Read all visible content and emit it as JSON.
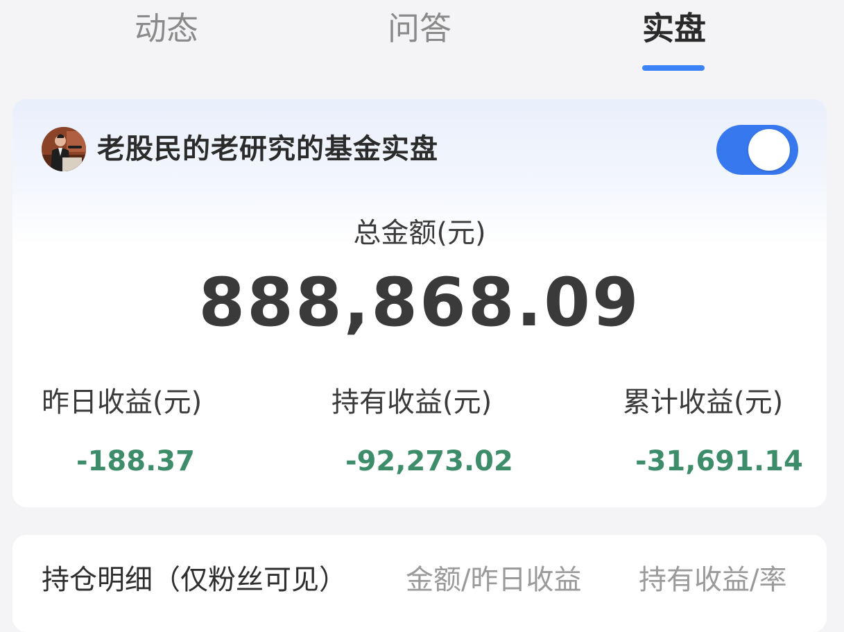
{
  "tabs": [
    {
      "label": "动态",
      "active": false
    },
    {
      "label": "问答",
      "active": false
    },
    {
      "label": "实盘",
      "active": true
    }
  ],
  "accent_color": "#3b82f6",
  "account": {
    "avatar_icon": "user-avatar",
    "title": "老股民的老研究的基金实盘",
    "toggle_on": true
  },
  "summary": {
    "total_label": "总金额(元)",
    "total_value": "888,868.09",
    "stats": [
      {
        "label": "昨日收益(元)",
        "value": "-188.37"
      },
      {
        "label": "持有收益(元)",
        "value": "-92,273.02"
      },
      {
        "label": "累计收益(元)",
        "value": "-31,691.14"
      }
    ],
    "loss_color": "#3d8c6a"
  },
  "holdings": {
    "title": "持仓明细（仅粉丝可见）",
    "columns": [
      "金额/昨日收益",
      "持有收益/率"
    ]
  }
}
